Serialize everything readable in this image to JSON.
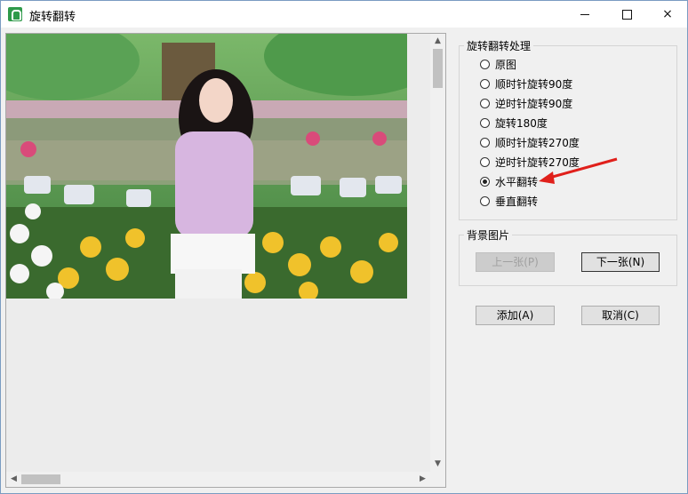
{
  "window": {
    "title": "旋转翻转",
    "controls": {
      "minimize": "minimize",
      "maximize": "maximize",
      "close": "×"
    }
  },
  "preview": {
    "scroll_up": "▲",
    "scroll_down": "▼",
    "scroll_left": "◀",
    "scroll_right": "▶"
  },
  "rotation_group": {
    "legend": "旋转翻转处理",
    "options": [
      {
        "label": "原图",
        "selected": false
      },
      {
        "label": "顺时针旋转90度",
        "selected": false
      },
      {
        "label": "逆时针旋转90度",
        "selected": false
      },
      {
        "label": "旋转180度",
        "selected": false
      },
      {
        "label": "顺时针旋转270度",
        "selected": false
      },
      {
        "label": "逆时针旋转270度",
        "selected": false
      },
      {
        "label": "水平翻转",
        "selected": true
      },
      {
        "label": "垂直翻转",
        "selected": false
      }
    ]
  },
  "background_group": {
    "legend": "背景图片",
    "prev_button": "上一张(P)",
    "next_button": "下一张(N)"
  },
  "actions": {
    "add_button": "添加(A)",
    "cancel_button": "取消(C)"
  },
  "colors": {
    "annotation_arrow": "#e0201b",
    "app_icon": "#2f9a4a"
  }
}
